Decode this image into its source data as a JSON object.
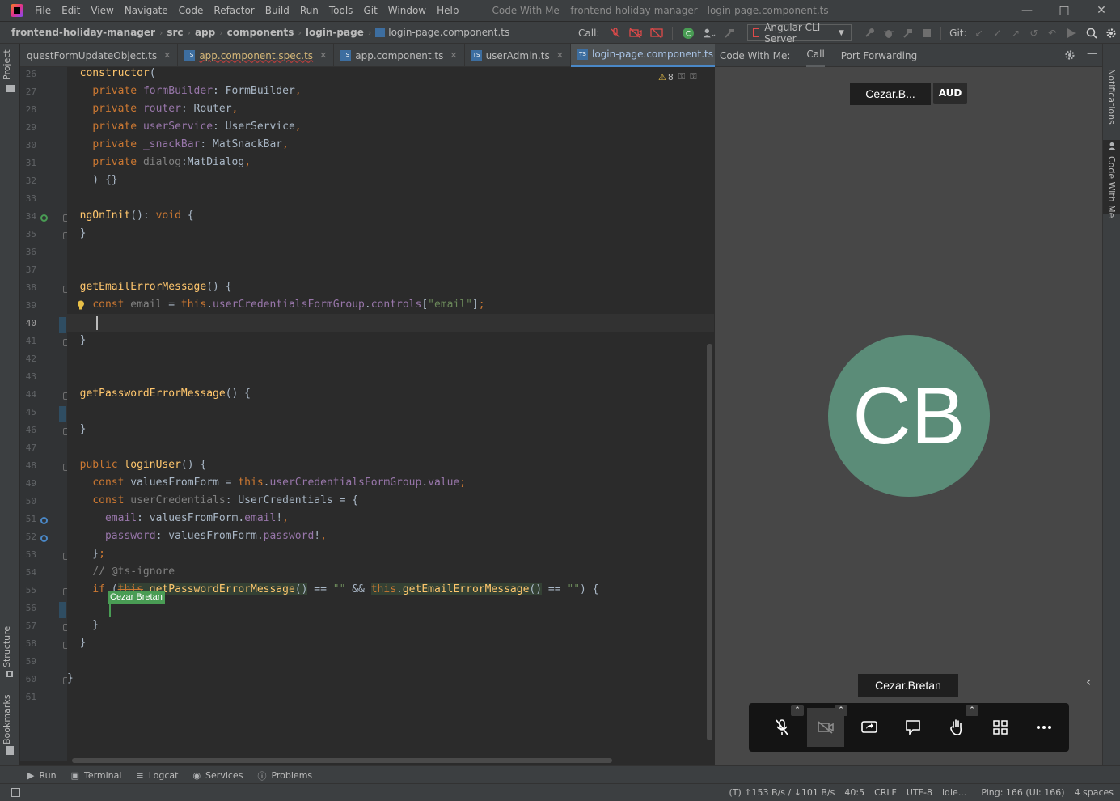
{
  "menu": {
    "items": [
      "File",
      "Edit",
      "View",
      "Navigate",
      "Code",
      "Refactor",
      "Build",
      "Run",
      "Tools",
      "Git",
      "Window",
      "Help"
    ],
    "title": "Code With Me – frontend-holiday-manager - login-page.component.ts"
  },
  "breadcrumb": {
    "items": [
      "frontend-holiday-manager",
      "src",
      "app",
      "components",
      "login-page",
      "login-page.component.ts"
    ]
  },
  "toolbar": {
    "call_label": "Call:",
    "run_config": "Angular CLI Server",
    "git_label": "Git:"
  },
  "tabs": [
    {
      "label": "questFormUpdateObject.ts",
      "active": false
    },
    {
      "label": "app.component.spec.ts",
      "active": false
    },
    {
      "label": "app.component.ts",
      "active": false
    },
    {
      "label": "userAdmin.ts",
      "active": false
    },
    {
      "label": "login-page.component.ts",
      "active": true
    }
  ],
  "side": {
    "project": "Project",
    "structure": "Structure",
    "bookmarks": "Bookmarks",
    "notifications": "Notifications",
    "codewithme": "Code With Me"
  },
  "editor": {
    "warning_count": "8",
    "user_flag": "Cezar Bretan",
    "line_numbers": [
      "26",
      "27",
      "28",
      "29",
      "30",
      "31",
      "32",
      "33",
      "34",
      "35",
      "36",
      "37",
      "38",
      "39",
      "40",
      "41",
      "42",
      "43",
      "44",
      "45",
      "46",
      "47",
      "48",
      "49",
      "50",
      "51",
      "52",
      "53",
      "54",
      "55",
      "56",
      "57",
      "58",
      "59",
      "60",
      "61"
    ],
    "current_line": "40"
  },
  "panel": {
    "tabs": [
      "Code With Me:",
      "Call",
      "Port Forwarding"
    ],
    "top_name": "Cezar.B...",
    "aud_label": "AUD",
    "avatar_initials": "CB",
    "bottom_name": "Cezar.Bretan"
  },
  "bottom_tools": [
    "Run",
    "Terminal",
    "Logcat",
    "Services",
    "Problems"
  ],
  "status": {
    "traffic": "(T) ↑153 B/s / ↓101 B/s",
    "position": "40:5",
    "line_sep": "CRLF",
    "encoding": "UTF-8",
    "state": "idle...",
    "ping": "Ping: 166 (UI: 166)",
    "indent": "4 spaces"
  },
  "colors": {
    "keyword": "#cc7832",
    "function": "#ffc66d",
    "property": "#9876aa",
    "string": "#6a8759",
    "avatar": "#5b8c78",
    "user_flag": "#499c54"
  }
}
